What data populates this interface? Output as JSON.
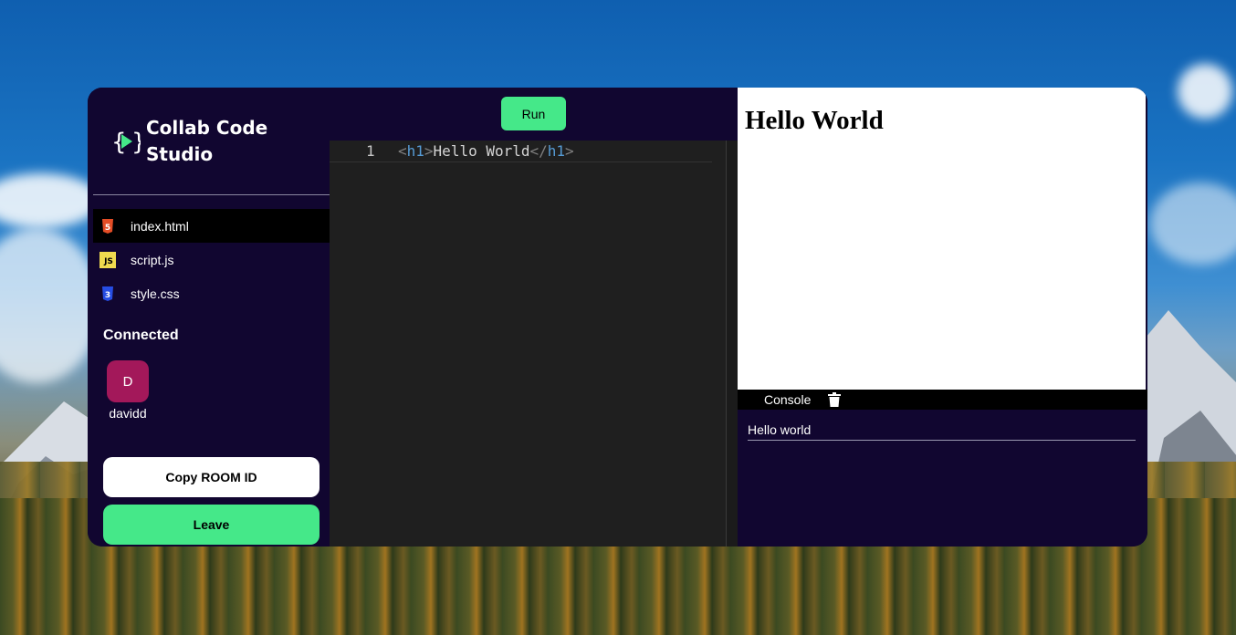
{
  "app": {
    "title": "Collab Code Studio"
  },
  "sidebar": {
    "files": [
      {
        "name": "index.html",
        "icon": "html5-icon",
        "active": true
      },
      {
        "name": "script.js",
        "icon": "javascript-icon",
        "active": false
      },
      {
        "name": "style.css",
        "icon": "css3-icon",
        "active": false
      }
    ],
    "connected_label": "Connected",
    "users": [
      {
        "initial": "D",
        "name": "davidd",
        "color": "#a3185a"
      }
    ],
    "copy_room_label": "Copy ROOM ID",
    "leave_label": "Leave"
  },
  "toolbar": {
    "run_label": "Run"
  },
  "editor": {
    "lines": [
      {
        "number": "1",
        "open_bracket": "<",
        "open_tag": "h1",
        "close_open": ">",
        "text": "Hello World",
        "close_bracket": "</",
        "close_tag": "h1",
        "end": ">"
      }
    ]
  },
  "preview": {
    "heading": "Hello World"
  },
  "console": {
    "label": "Console",
    "output": "Hello world"
  },
  "colors": {
    "accent": "#45e889",
    "panel": "#110630",
    "editor_bg": "#1f1f1f",
    "avatar": "#a3185a"
  }
}
